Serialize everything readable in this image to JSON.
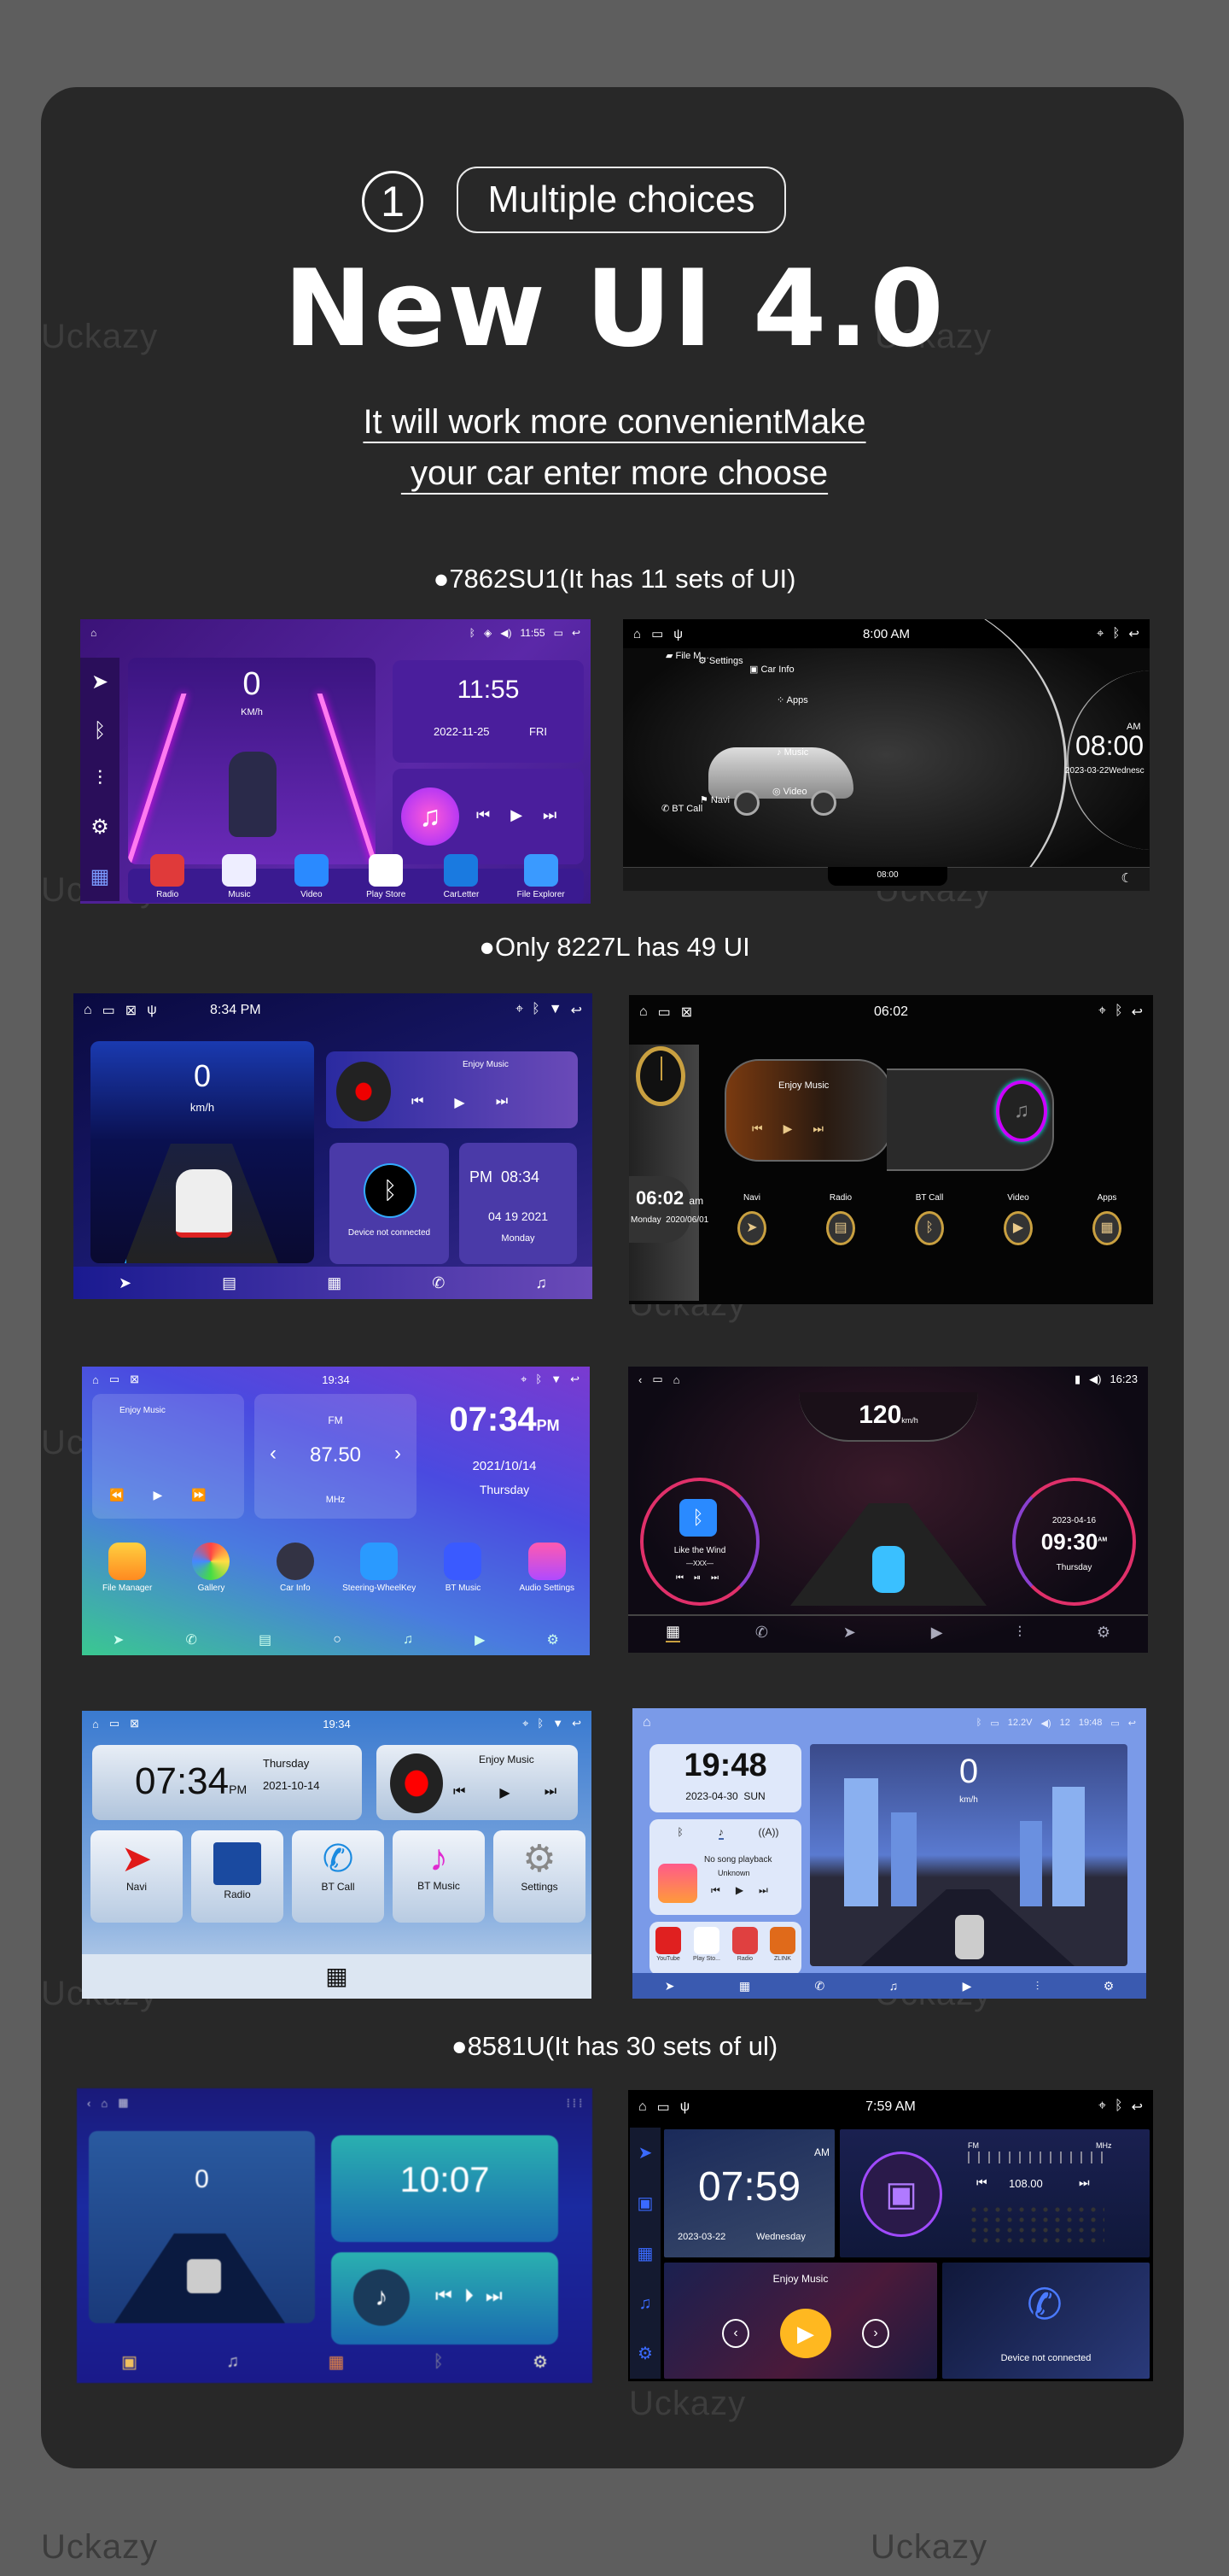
{
  "header": {
    "step_number": "1",
    "tag": "Multiple choices",
    "title": "New UI 4.0",
    "subtitle_line1": "It will work more convenientMake",
    "subtitle_line2": " your car enter more choose"
  },
  "sections": {
    "s1": "●7862SU1(It has 11 sets of UI)",
    "s2": "●Only 8227L has 49 UI",
    "s3": "●8581U(It has 30 sets of ul)"
  },
  "watermark": "Uckazy",
  "colors": {
    "background": "#5e5e5e",
    "card": "#282828",
    "text": "#ffffff"
  },
  "screens": {
    "s1": {
      "status_time": "11:55",
      "speed": "0",
      "speed_unit": "KM/h",
      "clock": "11:55",
      "date": "2022-11-25",
      "weekday": "FRI",
      "apps": [
        "Radio",
        "Music",
        "Video",
        "Play Store",
        "CarLetter",
        "File Explorer"
      ]
    },
    "s2": {
      "status_time": "8:00 AM",
      "menu": [
        "File M...",
        "Settings",
        "Car Info",
        "Apps",
        "Music",
        "Video",
        "Navi",
        "BT Call"
      ],
      "ampm": "AM",
      "clock": "08:00",
      "date": "2023-03-22Wednesc",
      "bottom_time": "08:00"
    },
    "s3": {
      "status_time": "8:34 PM",
      "speed": "0",
      "speed_unit": "km/h",
      "music_title": "Enjoy Music",
      "bt_status": "Device not connected",
      "ampm": "PM",
      "clock": "08:34",
      "date": "04 19 2021",
      "weekday": "Monday"
    },
    "s4": {
      "status_time": "06:02",
      "music_title": "Enjoy Music",
      "apps": [
        "Navi",
        "Radio",
        "BT Call",
        "Video",
        "Apps"
      ],
      "clock": "06:02",
      "ampm": "am",
      "weekday": "Monday",
      "date": "2020/06/01"
    },
    "s5": {
      "status_time": "19:34",
      "music_title": "Enjoy Music",
      "band": "FM",
      "frequency": "87.50",
      "freq_unit": "MHz",
      "clock": "07:34",
      "ampm": "PM",
      "date": "2021/10/14",
      "weekday": "Thursday",
      "apps": [
        "File Manager",
        "Gallery",
        "Car Info",
        "Steering-WheelKey",
        "BT Music",
        "Audio Settings"
      ]
    },
    "s6": {
      "status_time": "16:23",
      "speed": "120",
      "speed_unit": "km/h",
      "song": "Like the Wind",
      "artist": "—XXX—",
      "date": "2023-04-16",
      "clock": "09:30",
      "ampm": "AM",
      "weekday": "Thursday"
    },
    "s7": {
      "status_time": "19:34",
      "clock": "07:34",
      "ampm": "PM",
      "weekday": "Thursday",
      "date": "2021-10-14",
      "music_title": "Enjoy Music",
      "tiles": [
        "Navi",
        "Radio",
        "BT Call",
        "BT Music",
        "Settings"
      ]
    },
    "s8": {
      "voltage": "12.2V",
      "volume": "12",
      "status_time": "19:48",
      "clock": "19:48",
      "date": "2023-04-30  SUN",
      "song": "No song playback",
      "artist": "Unknown",
      "apps": [
        "YouTube",
        "Play Sto...",
        "Radio",
        "ZLINK"
      ],
      "speed": "0",
      "speed_unit": "km/h"
    },
    "s9": {
      "speed": "0",
      "clock": "10:07"
    },
    "s10": {
      "status_time": "7:59 AM",
      "ampm": "AM",
      "clock": "07:59",
      "date": "2023-03-22",
      "weekday": "Wednesday",
      "band": "FM",
      "freq_unit": "MHz",
      "frequency": "108.00",
      "music_title": "Enjoy Music",
      "bt_status": "Device not connected"
    }
  }
}
